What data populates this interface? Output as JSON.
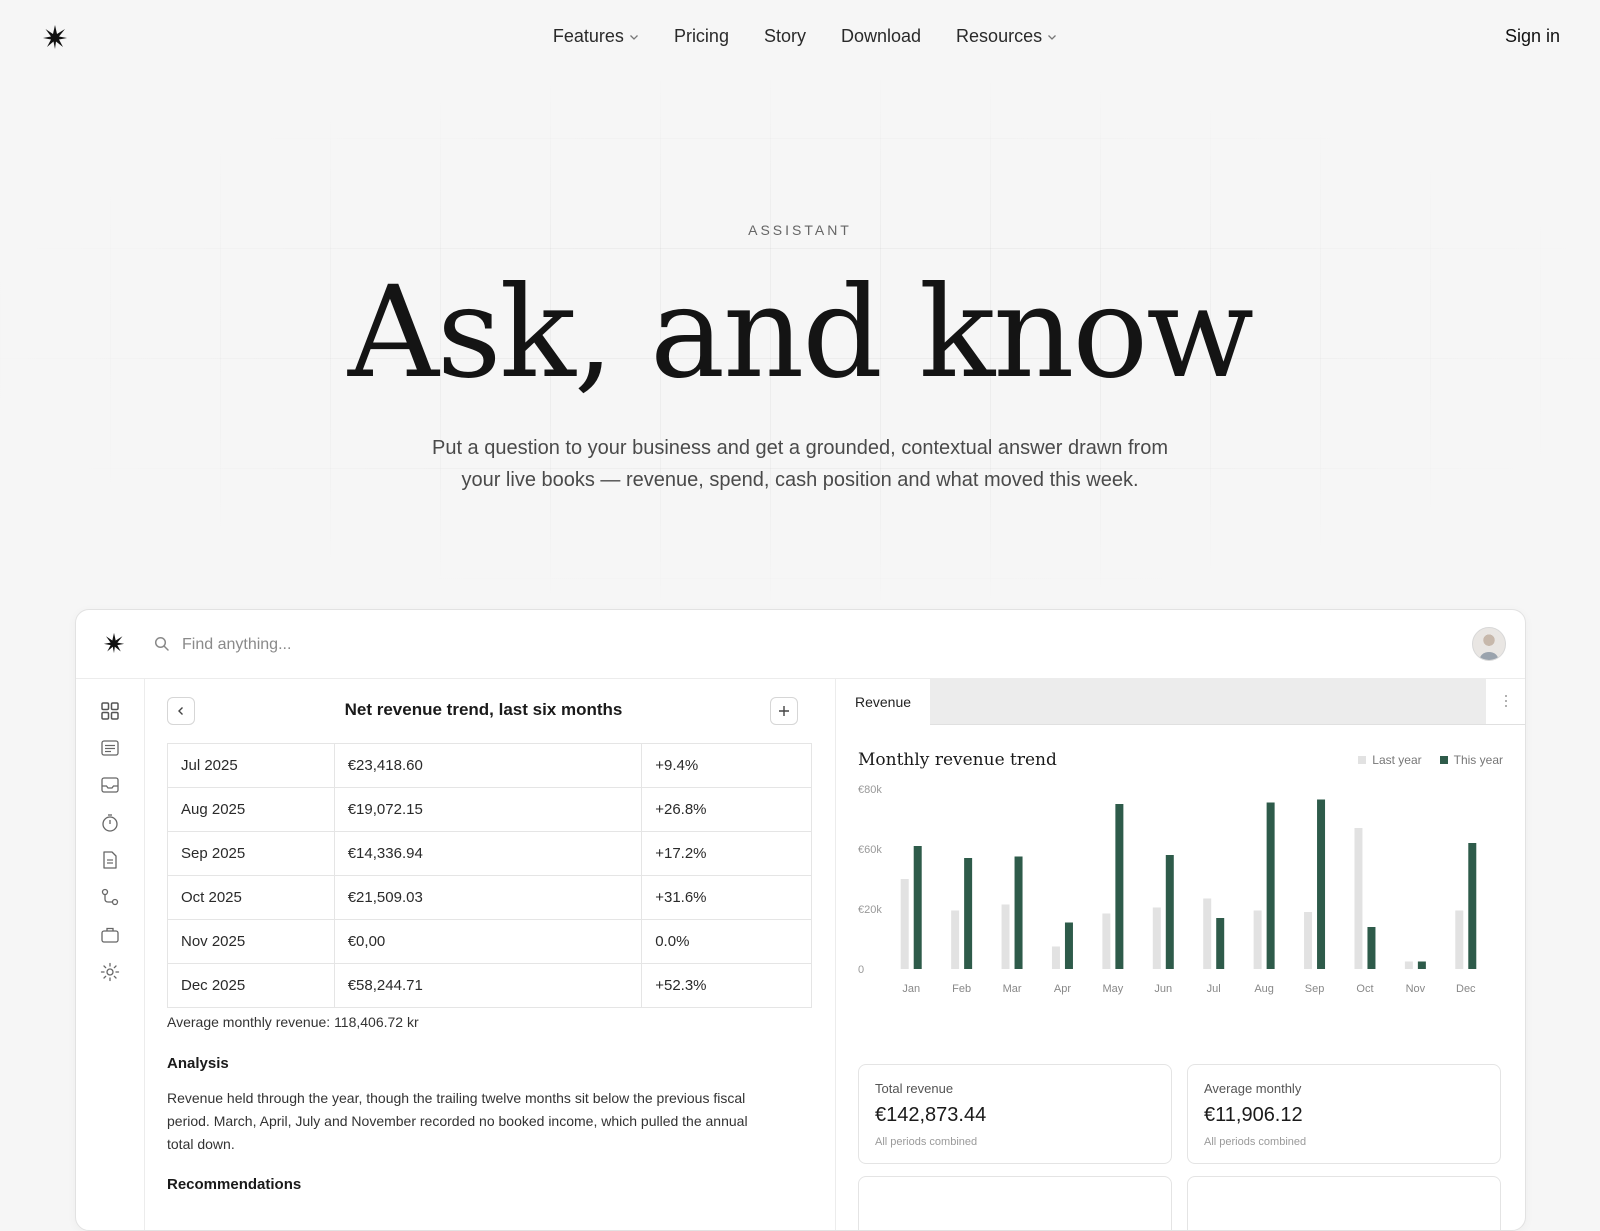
{
  "nav": {
    "logo_icon": "asterisk-star-icon",
    "links": [
      {
        "label": "Features",
        "has_dropdown": true
      },
      {
        "label": "Pricing",
        "has_dropdown": false
      },
      {
        "label": "Story",
        "has_dropdown": false
      },
      {
        "label": "Download",
        "has_dropdown": false
      },
      {
        "label": "Resources",
        "has_dropdown": true
      }
    ],
    "sign_in": "Sign in"
  },
  "hero": {
    "eyebrow": "ASSISTANT",
    "title": "Ask, and know",
    "subtitle": "Put a question to your business and get a grounded, contextual answer drawn from your live books — revenue, spend, cash position and what moved this week."
  },
  "app": {
    "search": {
      "placeholder": "Find anything..."
    },
    "sidebar_icons": [
      "grid-icon",
      "list-icon",
      "inbox-icon",
      "timer-icon",
      "document-icon",
      "flow-icon",
      "briefcase-icon",
      "settings-icon"
    ],
    "left_panel": {
      "title": "Net revenue trend, last six months",
      "rows": [
        {
          "month": "Jul 2025",
          "amount": "€23,418.60",
          "change": "+9.4%"
        },
        {
          "month": "Aug 2025",
          "amount": "€19,072.15",
          "change": "+26.8%"
        },
        {
          "month": "Sep 2025",
          "amount": "€14,336.94",
          "change": "+17.2%"
        },
        {
          "month": "Oct 2025",
          "amount": "€21,509.03",
          "change": "+31.6%"
        },
        {
          "month": "Nov 2025",
          "amount": "€0,00",
          "change": "0.0%"
        },
        {
          "month": "Dec 2025",
          "amount": "€58,244.71",
          "change": "+52.3%"
        }
      ],
      "average": "Average monthly revenue: 118,406.72 kr",
      "analysis_heading": "Analysis",
      "analysis_body": "Revenue held through the year, though the trailing twelve months sit below the previous fiscal period. March, April, July and November recorded no booked income, which pulled the annual total down.",
      "recommendations_heading": "Recommendations"
    },
    "right_panel": {
      "tab": "Revenue",
      "stats": [
        {
          "label": "Total revenue",
          "value": "€142,873.44",
          "sub": "All periods combined"
        },
        {
          "label": "Average monthly",
          "value": "€11,906.12",
          "sub": "All periods combined"
        }
      ]
    }
  },
  "colors": {
    "last_year": "#e2e2e2",
    "this_year": "#2e5b4a"
  },
  "chart_data": {
    "type": "bar",
    "title": "Monthly revenue trend",
    "categories": [
      "Jan",
      "Feb",
      "Mar",
      "Apr",
      "May",
      "Jun",
      "Jul",
      "Aug",
      "Sep",
      "Oct",
      "Nov",
      "Dec"
    ],
    "series": [
      {
        "name": "Last year",
        "values": [
          30000,
          19500,
          21500,
          7500,
          18500,
          20500,
          23500,
          19500,
          19000,
          47000,
          2500,
          19500
        ]
      },
      {
        "name": "This year",
        "values": [
          41000,
          37000,
          37500,
          15500,
          55000,
          38000,
          17000,
          55500,
          56500,
          14000,
          2500,
          42000
        ]
      }
    ],
    "y_ticks": [
      "0",
      "€20k",
      "€60k",
      "€80k"
    ],
    "y_tick_values": [
      0,
      20000,
      40000,
      60000
    ],
    "ylim": [
      0,
      60000
    ],
    "legend": "top-right",
    "grid": false
  }
}
